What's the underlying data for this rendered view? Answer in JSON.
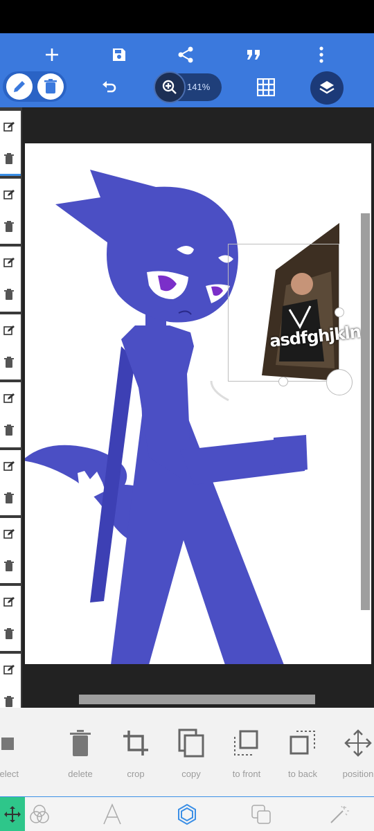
{
  "toolbar": {
    "actions": [
      {
        "icon": "plus-icon"
      },
      {
        "icon": "save-icon"
      },
      {
        "icon": "share-icon"
      },
      {
        "icon": "quote-icon"
      },
      {
        "icon": "more-vertical-icon"
      }
    ],
    "zoom_label": "141%",
    "accent": "#3b79dd"
  },
  "layers": {
    "count": 10,
    "row_icons": [
      "edit-icon",
      "trash-icon"
    ]
  },
  "canvas": {
    "sticker_caption": "asdfghjkln"
  },
  "tools": [
    {
      "label": "select",
      "icon": "select-icon"
    },
    {
      "label": "delete",
      "icon": "trash-icon"
    },
    {
      "label": "crop",
      "icon": "crop-icon"
    },
    {
      "label": "copy",
      "icon": "copy-icon"
    },
    {
      "label": "to front",
      "icon": "to-front-icon"
    },
    {
      "label": "to back",
      "icon": "to-back-icon"
    },
    {
      "label": "position",
      "icon": "move-icon"
    }
  ],
  "modes": [
    {
      "icon": "move-icon",
      "active": true
    },
    {
      "icon": "blend-icon"
    },
    {
      "icon": "text-icon"
    },
    {
      "icon": "hexagon-icon"
    },
    {
      "icon": "layers-copy-icon"
    },
    {
      "icon": "magic-wand-icon"
    }
  ]
}
